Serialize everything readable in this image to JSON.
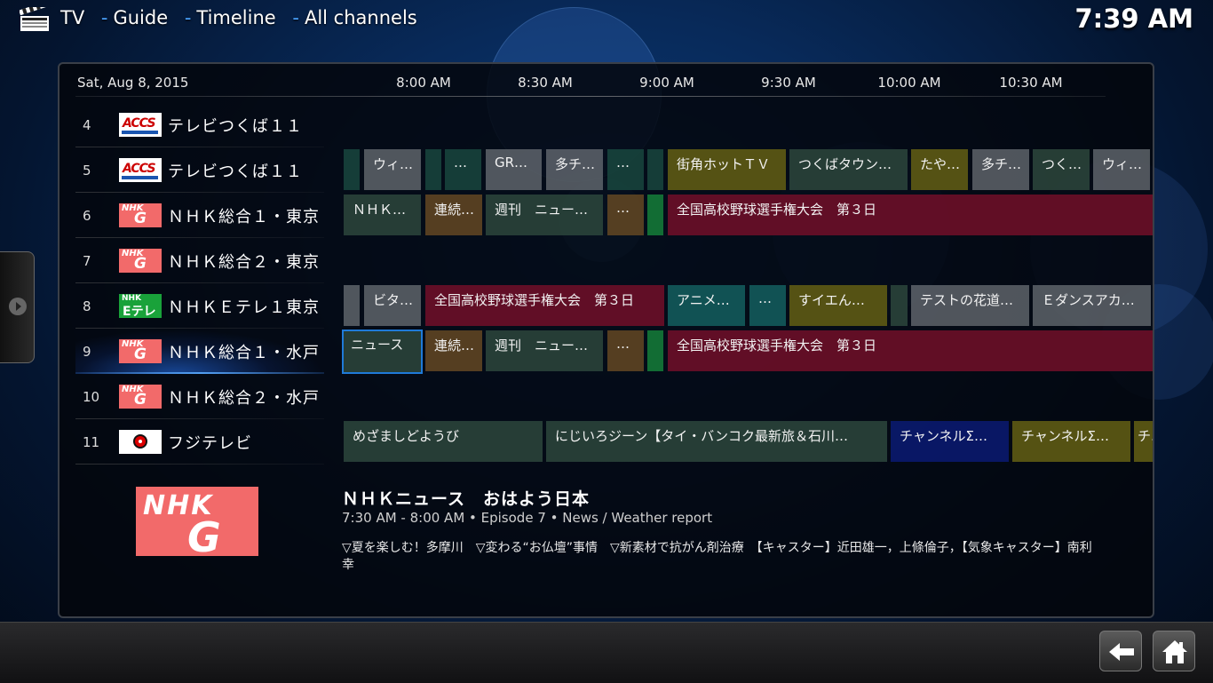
{
  "header": {
    "breadcrumb": [
      "TV",
      "Guide",
      "Timeline",
      "All channels"
    ],
    "clock": "7:39 AM",
    "separator": "-"
  },
  "guide": {
    "date": "Sat, Aug 8, 2015",
    "times": [
      "8:00 AM",
      "8:30 AM",
      "9:00 AM",
      "9:30 AM",
      "10:00 AM",
      "10:30 AM"
    ],
    "channels": [
      {
        "num": "4",
        "name": "テレビつくば１１",
        "logo": "accs-logo"
      },
      {
        "num": "5",
        "name": "テレビつくば１１",
        "logo": "accs-logo"
      },
      {
        "num": "6",
        "name": "ＮＨＫ総合１・東京",
        "logo": "nhk-g-logo"
      },
      {
        "num": "7",
        "name": "ＮＨＫ総合２・東京",
        "logo": "nhk-g-logo"
      },
      {
        "num": "8",
        "name": "ＮＨＫＥテレ１東京",
        "logo": "nhk-etele-logo"
      },
      {
        "num": "9",
        "name": "ＮＨＫ総合１・水戸",
        "logo": "nhk-g-logo"
      },
      {
        "num": "10",
        "name": "ＮＨＫ総合２・水戸",
        "logo": "nhk-g-logo"
      },
      {
        "num": "11",
        "name": "フジテレビ",
        "logo": "fuji-tv-logo"
      }
    ],
    "rows": {
      "ch5": [
        "",
        "ウィ…",
        "",
        "…",
        "GR…",
        "多チ…",
        "…",
        "",
        "街角ホットＴＶ",
        "つくばタウン…",
        "たや…",
        "多チ…",
        "つく…",
        "ウィ…"
      ],
      "ch6": [
        "ＮＨＫ…",
        "連続…",
        "週刊　ニュー…",
        "…",
        "",
        "全国高校野球選手権大会　第３日"
      ],
      "ch8": [
        "",
        "ビタ…",
        "全国高校野球選手権大会　第３日",
        "アニメ…",
        "…",
        "すイエん…",
        "",
        "テストの花道…",
        "Ｅダンスアカ…"
      ],
      "ch9": [
        "ニュース",
        "連続…",
        "週刊　ニュー…",
        "…",
        "",
        "全国高校野球選手権大会　第３日"
      ],
      "ch11": [
        "めざましどようび",
        "にじいろジーン【タイ・バンコク最新旅＆石川…",
        "チャンネルΣ…",
        "チャンネルΣ…",
        "チ"
      ]
    }
  },
  "info": {
    "logo_text": "NHK",
    "logo_letter": "G",
    "title": "ＮＨＫニュース　おはよう日本",
    "meta": "7:30 AM - 8:00 AM • Episode 7 • News / Weather report",
    "description": "▽夏を楽しむ！多摩川　▽変わる“お仏壇”事情　▽新素材で抗がん剤治療　【キャスター】近田雄一，上條倫子，【気象キャスター】南利幸"
  },
  "logos": {
    "accs": "ACCS",
    "nhk": "NHK",
    "g": "G",
    "etele": "Eテレ"
  },
  "colors": {
    "accent": "#4aa3ff",
    "focus": "#1f7ad8",
    "nhk_red": "#f26a6a",
    "etele_green": "#19a23a"
  },
  "icons": [
    "clapperboard-icon",
    "side-menu-arrow-icon",
    "back-arrow-icon",
    "home-icon"
  ]
}
